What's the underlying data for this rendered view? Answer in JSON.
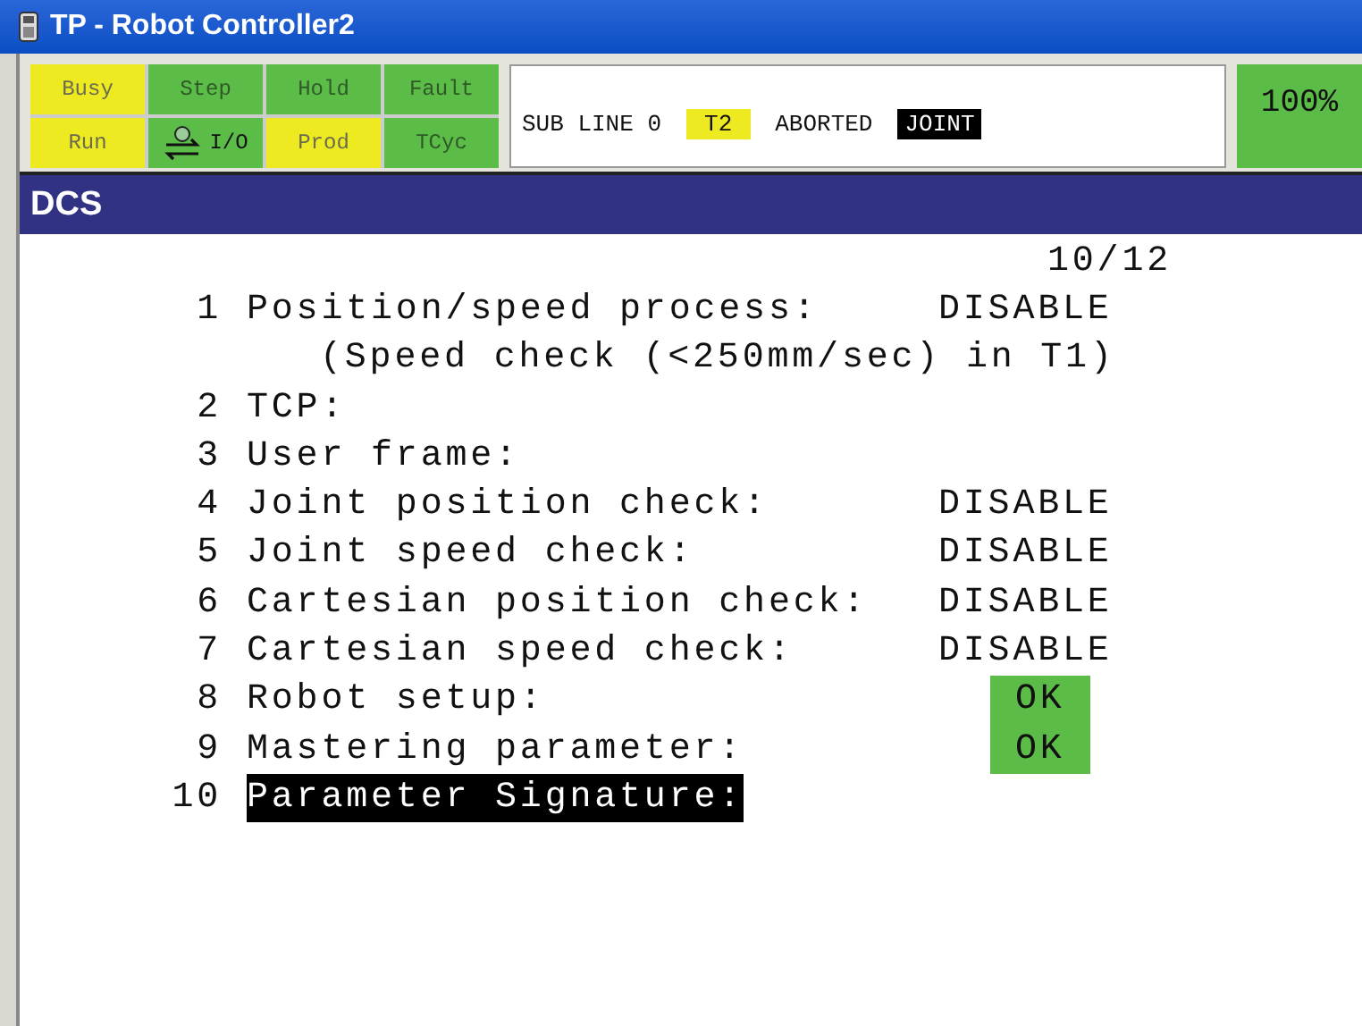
{
  "window": {
    "title": "TP - Robot Controller2"
  },
  "lamps": [
    {
      "label": "Busy",
      "kind": "lamp",
      "on": true
    },
    {
      "label": "Step",
      "kind": "lamp",
      "on": false
    },
    {
      "label": "Hold",
      "kind": "lamp",
      "on": false
    },
    {
      "label": "Fault",
      "kind": "lamp",
      "on": false
    },
    {
      "label": "Run",
      "kind": "lamp",
      "on": true
    },
    {
      "label": "I/O",
      "kind": "io",
      "on": false
    },
    {
      "label": "Prod",
      "kind": "lamp",
      "on": true
    },
    {
      "label": "TCyc",
      "kind": "lamp",
      "on": false
    }
  ],
  "status": {
    "line": "SUB LINE 0",
    "mode": "T2",
    "state": "ABORTED",
    "coord": "JOINT",
    "override": "100%"
  },
  "screen": {
    "title": "DCS",
    "page": "10/12"
  },
  "items": [
    {
      "number": "1",
      "label": "Position/speed process:",
      "value": "DISABLE",
      "kind": "setting",
      "note": "(Speed check (<250mm/sec) in T1)",
      "selected": false
    },
    {
      "number": "2",
      "label": "TCP:",
      "kind": "menu",
      "selected": false
    },
    {
      "number": "3",
      "label": "User frame:",
      "kind": "menu",
      "selected": false
    },
    {
      "number": "4",
      "label": "Joint position check:",
      "value": "DISABLE",
      "kind": "setting",
      "selected": false
    },
    {
      "number": "5",
      "label": "Joint speed check:",
      "value": "DISABLE",
      "kind": "setting",
      "selected": false
    },
    {
      "number": "6",
      "label": "Cartesian position check:",
      "value": "DISABLE",
      "kind": "setting",
      "selected": false
    },
    {
      "number": "7",
      "label": "Cartesian speed check:",
      "value": "DISABLE",
      "kind": "setting",
      "selected": false
    },
    {
      "number": "8",
      "label": "Robot setup:",
      "value": "OK",
      "kind": "check",
      "selected": false
    },
    {
      "number": "9",
      "label": "Mastering parameter:",
      "value": "OK",
      "kind": "check",
      "selected": false
    },
    {
      "number": "10",
      "label": "Parameter Signature:",
      "kind": "menu",
      "selected": true
    }
  ]
}
